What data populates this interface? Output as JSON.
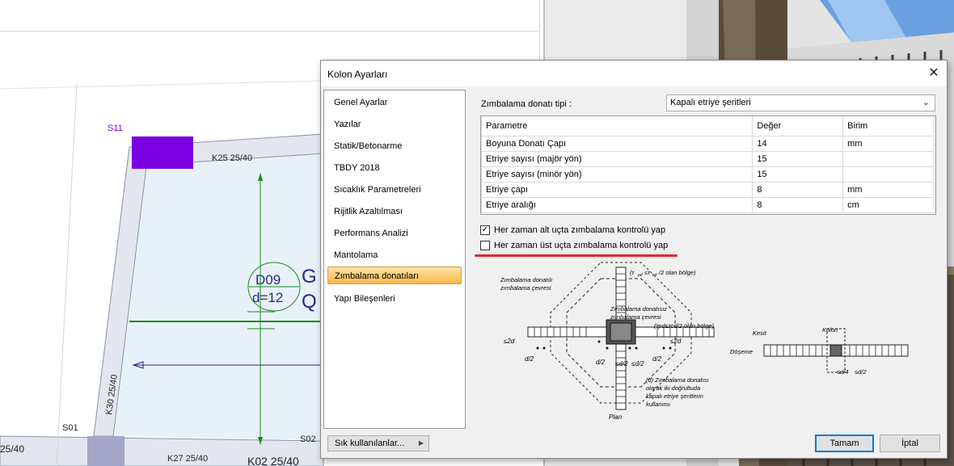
{
  "cad": {
    "labels": {
      "s11": "S11",
      "s01": "S01",
      "s02": "S02",
      "k25": "K25 25/40",
      "k27": "K27 25/40",
      "k02": "K02 25/40",
      "k30": "K30 25/40",
      "left_partial": "25/40",
      "d09": "D09",
      "d12": "d=12",
      "g": "G",
      "q": "Q"
    },
    "colors": {
      "column": "#7b00e0",
      "slab": "#e8f0f7",
      "green": "#1a8a1a",
      "blue": "#1f2a8c"
    }
  },
  "dialog": {
    "title": "Kolon Ayarları",
    "nav": [
      {
        "label": "Genel Ayarlar"
      },
      {
        "label": "Yazılar"
      },
      {
        "label": "Statik/Betonarme"
      },
      {
        "label": "TBDY 2018"
      },
      {
        "label": "Sıcaklık Parametreleri"
      },
      {
        "label": "Rijitlik Azaltılması"
      },
      {
        "label": "Performans Analizi"
      },
      {
        "label": "Mantolama"
      },
      {
        "label": "Zımbalama donatıları"
      },
      {
        "label": "Yapı Bileşenleri"
      }
    ],
    "selected_nav": "Zımbalama donatıları",
    "type_label": "Zımbalama donatı tipi :",
    "type_value": "Kapalı etriye şeritleri",
    "table": {
      "headers": [
        "Parametre",
        "Değer",
        "Birim"
      ],
      "rows": [
        [
          "Boyuna Donatı Çapı",
          "14",
          "mm"
        ],
        [
          "Etriye sayısı (majör yön)",
          "15",
          ""
        ],
        [
          "Etriye sayısı (minör yön)",
          "15",
          ""
        ],
        [
          "Etriye çapı",
          "8",
          "mm"
        ],
        [
          "Etriye aralığı",
          "8",
          "cm"
        ]
      ]
    },
    "check_bottom": {
      "label": "Her zaman alt uçta zımbalama kontrolü yap",
      "checked": true,
      "mark": "✓"
    },
    "check_top": {
      "label": "Her zaman üst uçta zımbalama kontrolü yap",
      "checked": false
    },
    "freq_button": "Sık kullanılanlar...",
    "ok_button": "Tamam",
    "cancel_button": "İptal",
    "figure": {
      "t1": "(τ",
      "t1b": "pd",
      "t1c": "≤τ",
      "t1d": "cd",
      "t1e": "/2 olan bölge)",
      "t2a": "Zımbalama donatılı",
      "t2b": "zımbalama çevresi",
      "t3a": "Zımbalama donatısız",
      "t3b": "zımbalama çevresi",
      "t4": "(τpd≤τcd/2 olan bölge)",
      "l2d": "≤2d",
      "r2d": "≤2d",
      "d2a": "d/2",
      "d2b": "d/2",
      "d2c": "d/2",
      "d2d": "≤d/2",
      "d2e": "≤d/2",
      "note1": "(d) Zımbalama donatısı",
      "note2": "olarak iki doğrultuda",
      "note3": "kapalı etriye şeritlerin",
      "note4": "kullanımı",
      "plan": "Plan",
      "kesit": "Kesit",
      "kolon": "Kolon",
      "doseme": "Döşeme",
      "d4": "≤d/4",
      "d2f": "≤d/2"
    }
  }
}
